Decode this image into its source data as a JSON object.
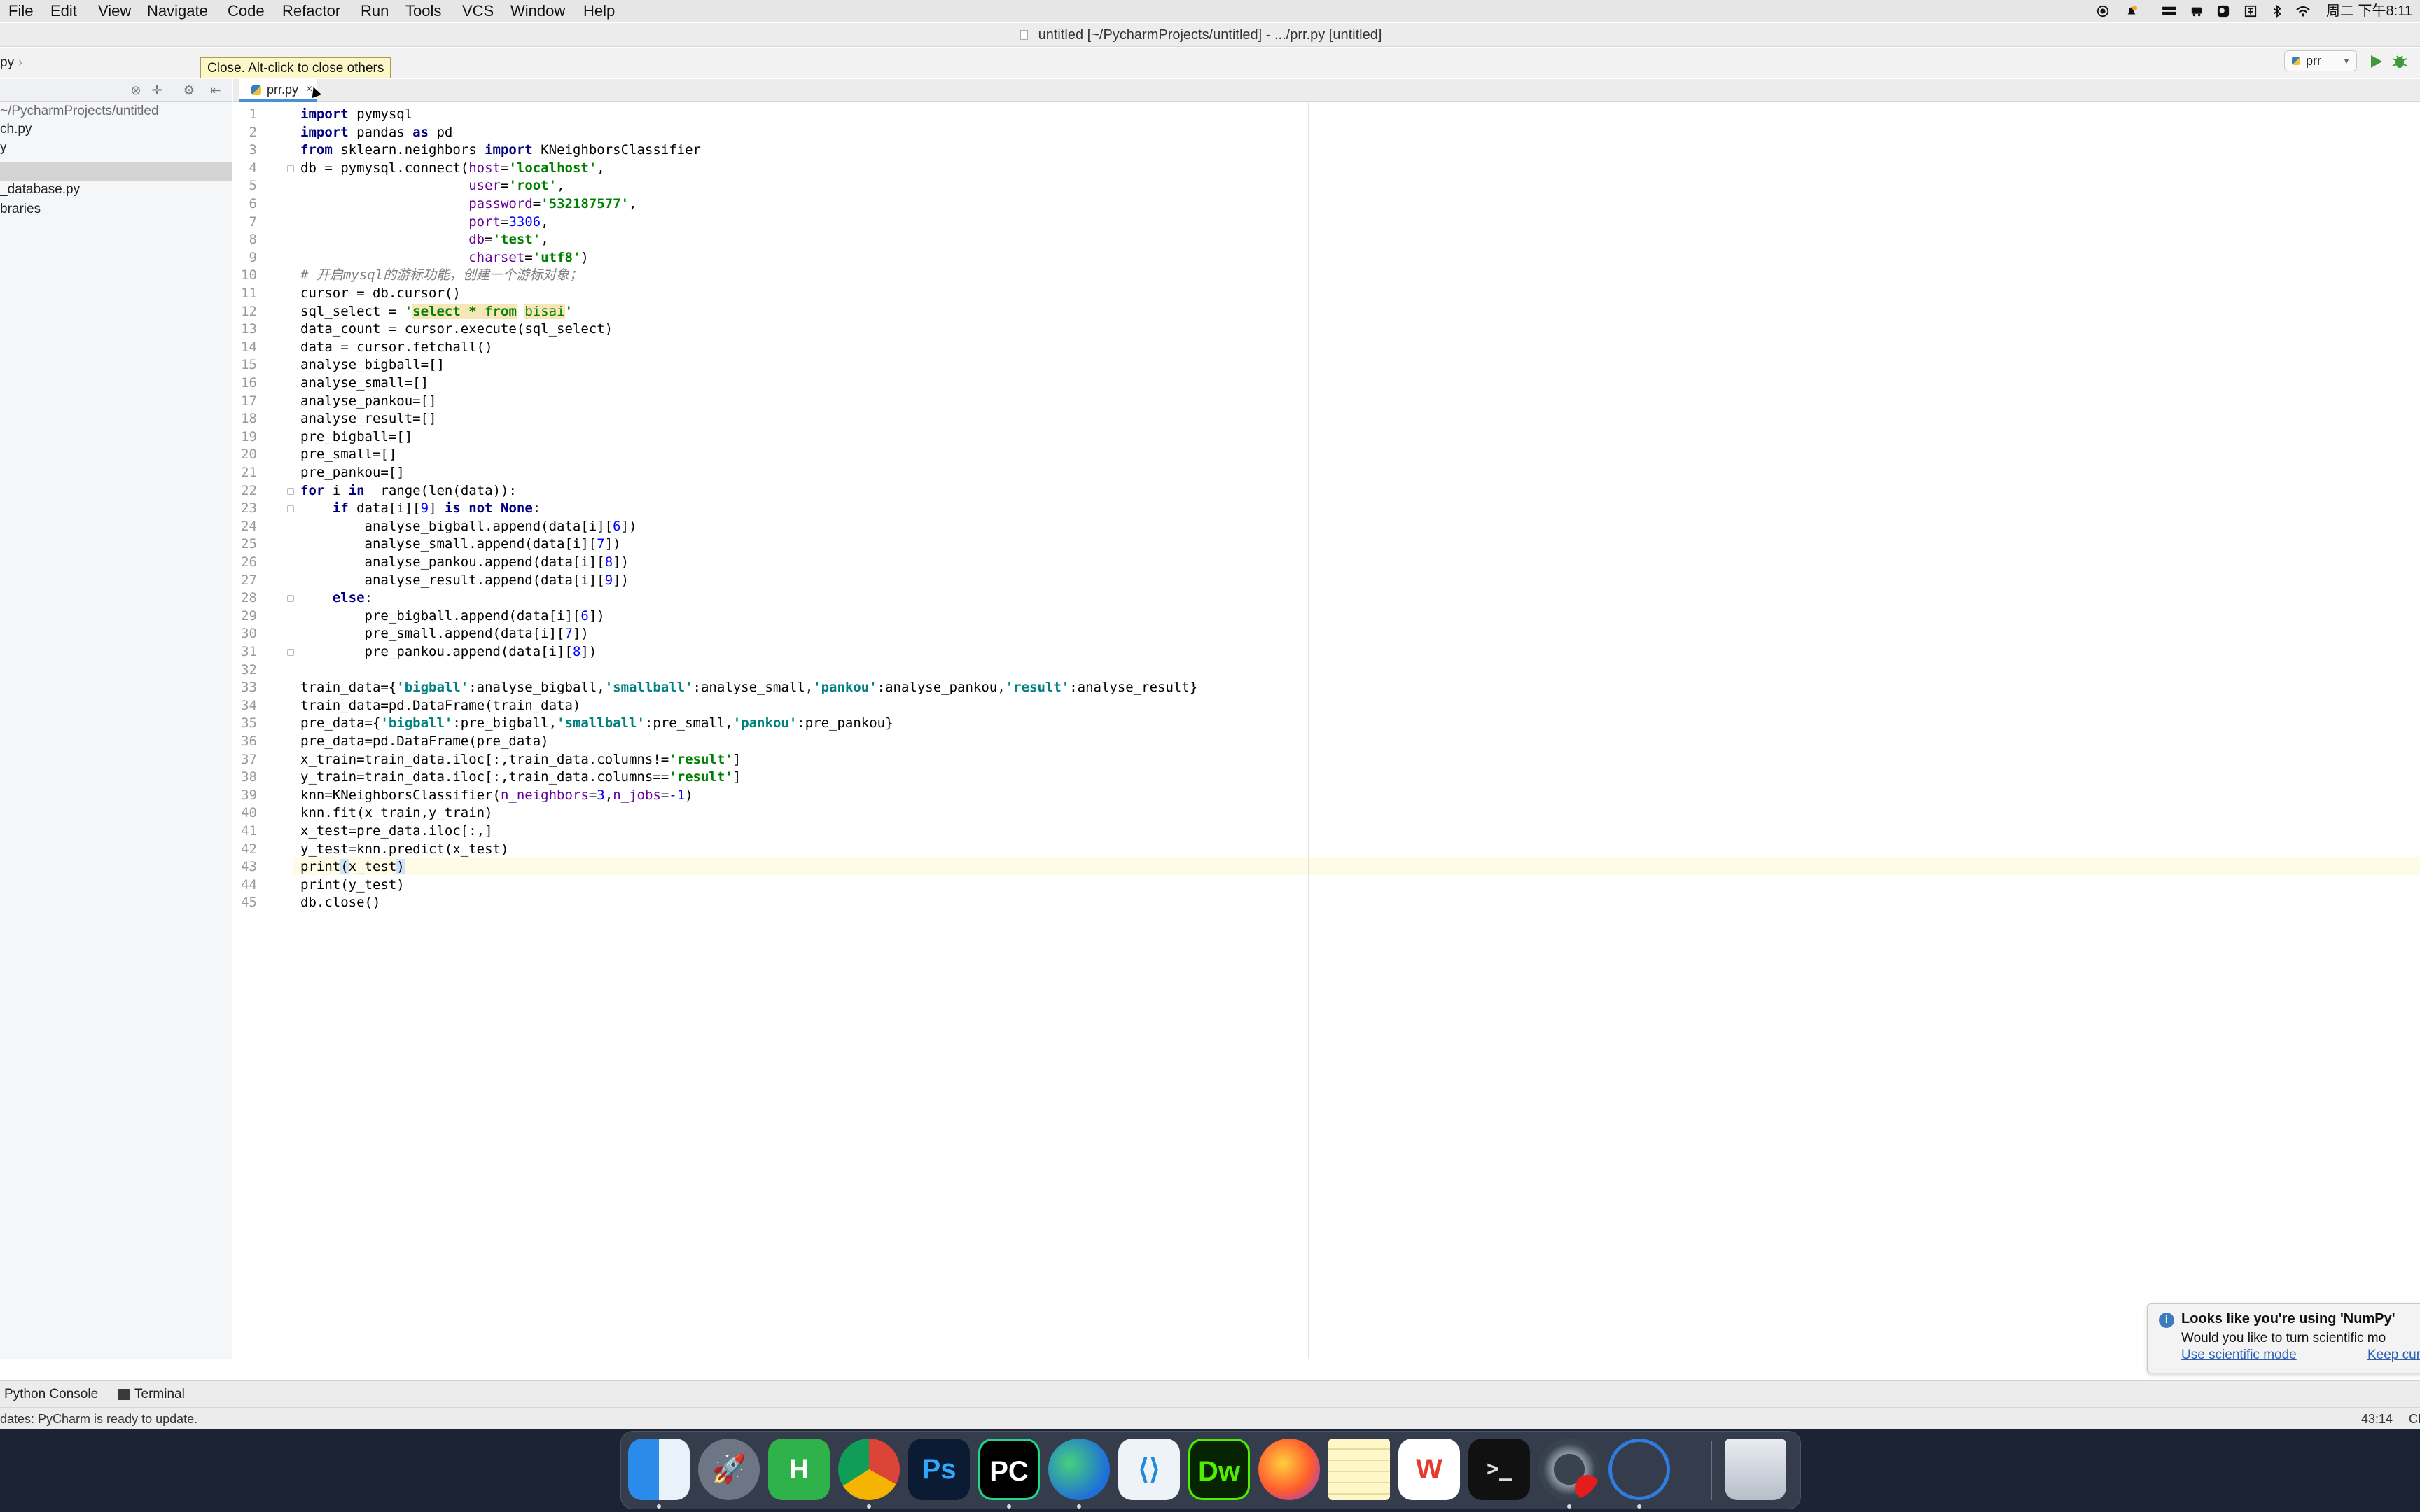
{
  "menubar": {
    "items": [
      "File",
      "Edit",
      "View",
      "Navigate",
      "Code",
      "Refactor",
      "Run",
      "Tools",
      "VCS",
      "Window",
      "Help"
    ],
    "clock": "周二 下午8:11"
  },
  "window": {
    "title": "untitled [~/PycharmProjects/untitled] - .../prr.py [untitled]"
  },
  "navbar": {
    "breadcrumb": "py",
    "run_config": "prr"
  },
  "tooltip": {
    "text": "Close. Alt-click to close others"
  },
  "project_tree": {
    "items": [
      {
        "label": "~/PycharmProjects/untitled",
        "kind": "path"
      },
      {
        "label": "ch.py",
        "kind": "file"
      },
      {
        "label": "y",
        "kind": "file"
      },
      {
        "label": "",
        "kind": "selected"
      },
      {
        "label": "_database.py",
        "kind": "file"
      },
      {
        "label": "braries",
        "kind": "folder"
      }
    ]
  },
  "editor": {
    "tab_label": "prr.py",
    "tab_close": "×",
    "line_count": 45,
    "current_line": 43
  },
  "notification": {
    "title": "Looks like you're using 'NumPy'",
    "body": "Would you like to turn scientific mo",
    "link1": "Use scientific mode",
    "link2": "Keep current la"
  },
  "toolwindows": {
    "python_console": "Python Console",
    "terminal": "Terminal"
  },
  "statusbar": {
    "message": "dates: PyCharm is ready to update.",
    "caret": "43:14",
    "line_sep": "CR"
  },
  "dock": {
    "apps": [
      "finder",
      "launchpad",
      "hbuilder",
      "chrome",
      "photoshop",
      "pycharm",
      "edge",
      "vscode",
      "dreamweaver",
      "firefox",
      "notes",
      "wps",
      "terminal",
      "screen-recorder",
      "navicat",
      "trash"
    ],
    "labels": {
      "hbuilder": "H",
      "photoshop": "Ps",
      "pycharm": "PC",
      "dreamweaver": "Dw",
      "wps": "W",
      "terminal": ">_"
    }
  },
  "colors": {
    "keyword": "#000080",
    "string": "#008000",
    "named_arg": "#660099",
    "number": "#0000ff",
    "comment": "#808080",
    "dict_key": "#008080",
    "notification_link": "#2d5fb4"
  }
}
